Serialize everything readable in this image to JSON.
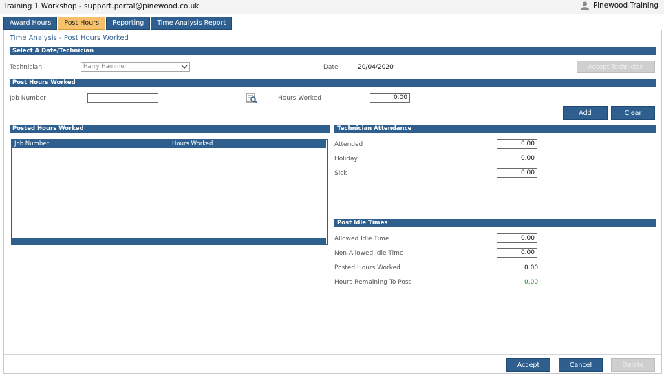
{
  "window": {
    "title": "Training 1 Workshop - support.portal@pinewood.co.uk",
    "user": "Pinewood Training"
  },
  "tabs": [
    {
      "label": "Award Hours",
      "active": false
    },
    {
      "label": "Post Hours",
      "active": true
    },
    {
      "label": "Reporting",
      "active": false
    },
    {
      "label": "Time Analysis Report",
      "active": false
    }
  ],
  "page": {
    "title": "Time Analysis - Post Hours Worked"
  },
  "select_section": {
    "header": "Select A Date/Technician",
    "technician_label": "Technician",
    "technician_value": "Harry Hammer",
    "date_label": "Date",
    "date_value": "20/04/2020",
    "accept_technician_label": "Accept Technician"
  },
  "post_section": {
    "header": "Post Hours Worked",
    "job_number_label": "Job Number",
    "job_number_value": "",
    "hours_worked_label": "Hours Worked",
    "hours_worked_value": "0.00",
    "add_label": "Add",
    "clear_label": "Clear"
  },
  "posted_section": {
    "header": "Posted Hours Worked",
    "columns": [
      "Job Number",
      "Hours Worked"
    ],
    "rows": []
  },
  "attendance_section": {
    "header": "Technician Attendance",
    "fields": [
      {
        "label": "Attended",
        "value": "0.00"
      },
      {
        "label": "Holiday",
        "value": "0.00"
      },
      {
        "label": "Sick",
        "value": "0.00"
      }
    ]
  },
  "idle_section": {
    "header": "Post Idle Times",
    "allowed_label": "Allowed Idle Time",
    "allowed_value": "0.00",
    "non_allowed_label": "Non-Allowed Idle Time",
    "non_allowed_value": "0.00",
    "posted_hours_label": "Posted Hours Worked",
    "posted_hours_value": "0.00",
    "remaining_label": "Hours Remaining To Post",
    "remaining_value": "0.00"
  },
  "footer": {
    "accept_label": "Accept",
    "cancel_label": "Cancel",
    "delete_label": "Delete"
  },
  "colors": {
    "accent": "#2f5f8e",
    "active_tab": "#f7c06a",
    "positive": "#1a8a1a"
  }
}
